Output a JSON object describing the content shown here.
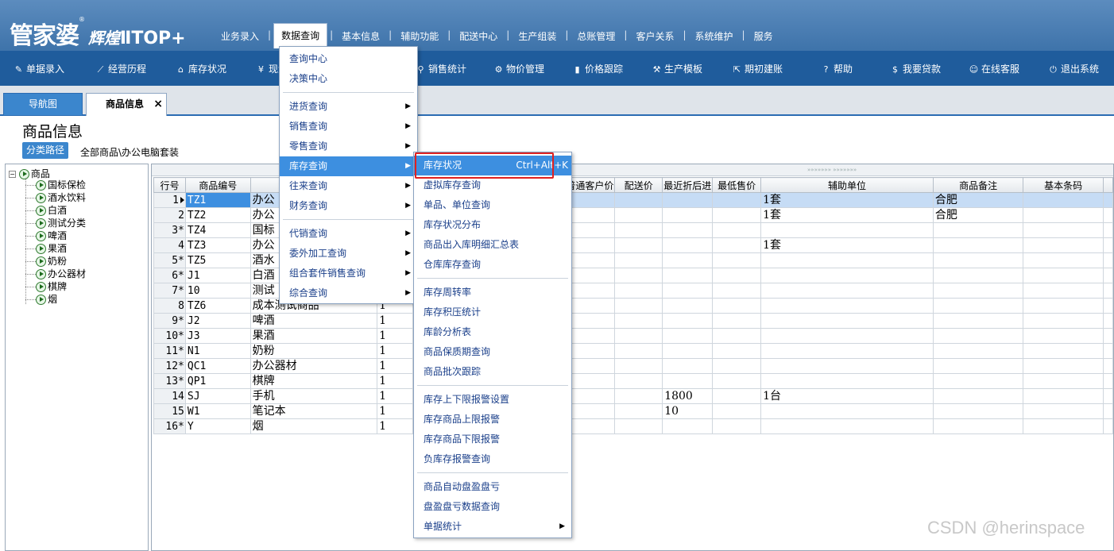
{
  "header": {
    "brand": "管家婆",
    "brand_mark": "®",
    "edition": "辉煌",
    "product": "ⅡTOP+",
    "menu": [
      {
        "label": "业务录入",
        "active": false
      },
      {
        "label": "数据查询",
        "active": true
      },
      {
        "label": "基本信息",
        "active": false
      },
      {
        "label": "辅助功能",
        "active": false
      },
      {
        "label": "配送中心",
        "active": false
      },
      {
        "label": "生产组装",
        "active": false
      },
      {
        "label": "总账管理",
        "active": false
      },
      {
        "label": "客户关系",
        "active": false
      },
      {
        "label": "系统维护",
        "active": false
      },
      {
        "label": "服务",
        "active": false
      }
    ]
  },
  "toolbar": [
    {
      "label": "单据录入",
      "icon": "document-edit-icon"
    },
    {
      "label": "经营历程",
      "icon": "trend-line-icon"
    },
    {
      "label": "库存状况",
      "icon": "home-icon"
    },
    {
      "label": "现金",
      "icon": "yen-icon"
    },
    {
      "label": "销售统计",
      "icon": "search-icon"
    },
    {
      "label": "物价管理",
      "icon": "gear-icon"
    },
    {
      "label": "价格跟踪",
      "icon": "bar-chart-icon"
    },
    {
      "label": "生产模板",
      "icon": "wrench-icon"
    },
    {
      "label": "期初建账",
      "icon": "external-link-icon"
    },
    {
      "label": "帮助",
      "icon": "help-icon"
    },
    {
      "label": "我要贷款",
      "icon": "money-bag-icon"
    },
    {
      "label": "在线客服",
      "icon": "chat-icon"
    },
    {
      "label": "退出系统",
      "icon": "power-icon"
    }
  ],
  "tabs": {
    "nav": "导航图",
    "goods": "商品信息",
    "close": "×"
  },
  "page": {
    "title": "商品信息",
    "path_label": "分类路径",
    "path_value": "全部商品\\办公电脑套装"
  },
  "tree": {
    "expander": "−",
    "root": "商品",
    "items": [
      "国标保检",
      "酒水饮料",
      "白酒",
      "测试分类",
      "啤酒",
      "果酒",
      "奶粉",
      "办公器材",
      "棋牌",
      "烟"
    ]
  },
  "grid": {
    "splitter_grip": "»»»»»»»  »»»»»»»",
    "columns": [
      "行号",
      "商品编号",
      "",
      "",
      "普通客户价",
      "配送价",
      "最近折后进",
      "最低售价",
      "辅助单位",
      "商品备注",
      "基本条码",
      ""
    ],
    "rows": [
      {
        "num": "1",
        "code": "TZ1",
        "name": "办公",
        "qty": "",
        "price": "",
        "aux_unit": "1套",
        "note": "合肥",
        "selected": true
      },
      {
        "num": "2",
        "code": "TZ2",
        "name": "办公",
        "qty": "",
        "price": "",
        "aux_unit": "1套",
        "note": "合肥",
        "selected": false
      },
      {
        "num": "3*",
        "code": "TZ4",
        "name": "国标",
        "qty": "",
        "price": "",
        "aux_unit": "",
        "note": "",
        "selected": false
      },
      {
        "num": "4",
        "code": "TZ3",
        "name": "办公",
        "qty": "",
        "price": "",
        "aux_unit": "1套",
        "note": "",
        "selected": false
      },
      {
        "num": "5*",
        "code": "TZ5",
        "name": "酒水",
        "qty": "",
        "price": "",
        "aux_unit": "",
        "note": "",
        "selected": false
      },
      {
        "num": "6*",
        "code": "J1",
        "name": "白酒",
        "qty": "",
        "price": "",
        "aux_unit": "",
        "note": "",
        "selected": false
      },
      {
        "num": "7*",
        "code": "10",
        "name": "测试",
        "qty": "",
        "price": "",
        "aux_unit": "",
        "note": "",
        "selected": false
      },
      {
        "num": "8",
        "code": "TZ6",
        "name": "成本测试商品",
        "qty": "1",
        "price": "",
        "aux_unit": "",
        "note": "",
        "selected": false
      },
      {
        "num": "9*",
        "code": "J2",
        "name": "啤酒",
        "qty": "1",
        "price": "",
        "aux_unit": "",
        "note": "",
        "selected": false
      },
      {
        "num": "10*",
        "code": "J3",
        "name": "果酒",
        "qty": "1",
        "price": "",
        "aux_unit": "",
        "note": "",
        "selected": false
      },
      {
        "num": "11*",
        "code": "N1",
        "name": "奶粉",
        "qty": "1",
        "price": "",
        "aux_unit": "",
        "note": "",
        "selected": false
      },
      {
        "num": "12*",
        "code": "QC1",
        "name": "办公器材",
        "qty": "1",
        "price": "",
        "aux_unit": "",
        "note": "",
        "selected": false
      },
      {
        "num": "13*",
        "code": "QP1",
        "name": "棋牌",
        "qty": "1",
        "price": "",
        "aux_unit": "",
        "note": "",
        "selected": false
      },
      {
        "num": "14",
        "code": "SJ",
        "name": "手机",
        "qty": "1",
        "price": "1800",
        "aux_unit": "1台",
        "note": "",
        "selected": false
      },
      {
        "num": "15",
        "code": "W1",
        "name": "笔记本",
        "qty": "1",
        "price": "10",
        "aux_unit": "",
        "note": "",
        "selected": false
      },
      {
        "num": "16*",
        "code": "Y",
        "name": "烟",
        "qty": "1",
        "price": "",
        "aux_unit": "",
        "note": "",
        "selected": false
      }
    ]
  },
  "data_query_menu": [
    {
      "label": "查询中心",
      "submenu": false,
      "highlighted": false
    },
    {
      "label": "决策中心",
      "submenu": false,
      "highlighted": false
    },
    {
      "separator": true
    },
    {
      "label": "进货查询",
      "submenu": true,
      "highlighted": false
    },
    {
      "label": "销售查询",
      "submenu": true,
      "highlighted": false
    },
    {
      "label": "零售查询",
      "submenu": true,
      "highlighted": false
    },
    {
      "label": "库存查询",
      "submenu": true,
      "highlighted": true
    },
    {
      "label": "往来查询",
      "submenu": true,
      "highlighted": false
    },
    {
      "label": "财务查询",
      "submenu": true,
      "highlighted": false
    },
    {
      "separator": true
    },
    {
      "label": "代销查询",
      "submenu": true,
      "highlighted": false
    },
    {
      "label": "委外加工查询",
      "submenu": true,
      "highlighted": false
    },
    {
      "label": "组合套件销售查询",
      "submenu": true,
      "highlighted": false
    },
    {
      "label": "综合查询",
      "submenu": true,
      "highlighted": false
    }
  ],
  "stock_submenu": [
    {
      "label": "库存状况",
      "shortcut": "Ctrl+Alt+K",
      "highlighted": true
    },
    {
      "label": "虚拟库存查询"
    },
    {
      "label": "单品、单位查询"
    },
    {
      "label": "库存状况分布"
    },
    {
      "label": "商品出入库明细汇总表"
    },
    {
      "label": "仓库库存查询"
    },
    {
      "separator": true
    },
    {
      "label": "库存周转率"
    },
    {
      "label": "库存积压统计"
    },
    {
      "label": "库龄分析表"
    },
    {
      "label": "商品保质期查询"
    },
    {
      "label": "商品批次跟踪"
    },
    {
      "separator": true
    },
    {
      "label": "库存上下限报警设置"
    },
    {
      "label": "库存商品上限报警"
    },
    {
      "label": "库存商品下限报警"
    },
    {
      "label": "负库存报警查询"
    },
    {
      "separator": true
    },
    {
      "label": "商品自动盘盈盘亏"
    },
    {
      "label": "盘盈盘亏数据查询"
    },
    {
      "label": "单据统计",
      "submenu": true
    }
  ],
  "watermark": "CSDN @herinspace",
  "colors": {
    "header_top": "#5c8cbe",
    "toolbar": "#1f5c9c",
    "menu_highlight": "#3d8fe0",
    "menu_text": "#1a3f8a",
    "red_box": "#e02020",
    "selected_row": "#c6dcf5"
  }
}
